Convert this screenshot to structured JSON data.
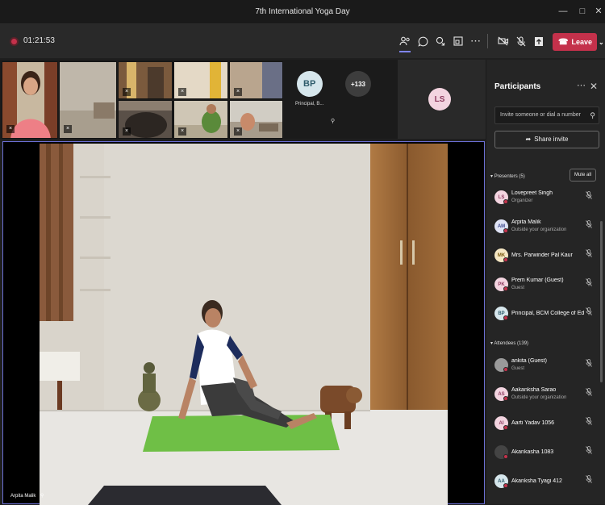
{
  "window": {
    "title": "7th International Yoga Day"
  },
  "toolbar": {
    "timer": "01:21:53",
    "leave_label": "Leave"
  },
  "gallery": {
    "principal_initials": "BP",
    "principal_caption": "Principal, B...",
    "overflow_count": "+133",
    "ls_initials": "LS"
  },
  "stage": {
    "presenter_name": "Arpita Malik"
  },
  "panel": {
    "title": "Participants",
    "invite_placeholder": "Invite someone or dial a number",
    "share_invite_label": "Share invite",
    "presenters_header": "Presenters (5)",
    "mute_all_label": "Mute all",
    "attendees_header": "Attendees (139)",
    "presenters": [
      {
        "initials": "LS",
        "name": "Lovepreet Singh",
        "sub": "Organizer",
        "color": "#f3d4e0",
        "text": "#8e3b5f"
      },
      {
        "initials": "AM",
        "name": "Arpita Malik",
        "sub": "Outside your organization",
        "color": "#dfe3f5",
        "text": "#3e4a8f"
      },
      {
        "initials": "MK",
        "name": "Mrs. Parwinder Pal Kaur",
        "sub": "",
        "color": "#f5e7c4",
        "text": "#7a5a10"
      },
      {
        "initials": "PK",
        "name": "Prem Kumar (Guest)",
        "sub": "Guest",
        "color": "#f3d4e0",
        "text": "#8e3b5f"
      },
      {
        "initials": "BP",
        "name": "Principal, BCM College of Edu...",
        "sub": "",
        "color": "#d6e6ec",
        "text": "#2f5b6b"
      }
    ],
    "attendees": [
      {
        "initials": "",
        "name": "ankita (Guest)",
        "sub": "Guest",
        "color": "#9a9a9a",
        "text": "#fff"
      },
      {
        "initials": "AS",
        "name": "Aakanksha Sarao",
        "sub": "Outside your organization",
        "color": "#f3d4e0",
        "text": "#8e3b5f"
      },
      {
        "initials": "AI",
        "name": "Aarti Yadav 1056",
        "sub": "",
        "color": "#f3d4e0",
        "text": "#8e3b5f"
      },
      {
        "initials": "",
        "name": "Akankasha 1083",
        "sub": "",
        "color": "#444",
        "text": "#fff"
      },
      {
        "initials": "AA",
        "name": "Akanksha Tyagi 412",
        "sub": "",
        "color": "#d6e6ec",
        "text": "#2f5b6b"
      }
    ]
  }
}
